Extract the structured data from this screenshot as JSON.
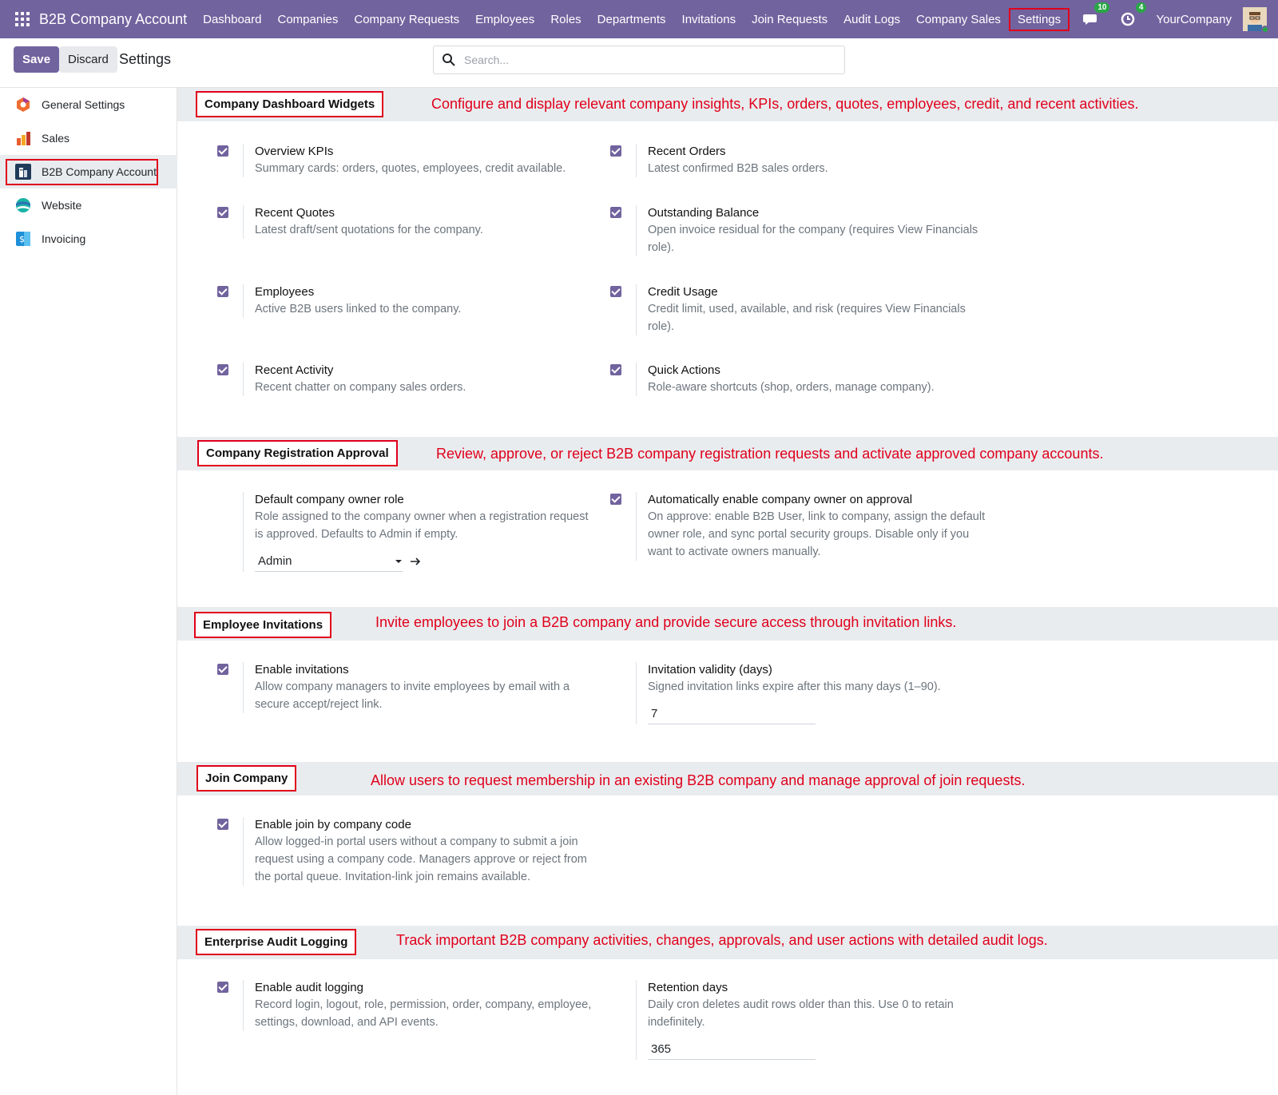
{
  "navbar": {
    "app_title": "B2B Company Account",
    "menu": [
      "Dashboard",
      "Companies",
      "Company Requests",
      "Employees",
      "Roles",
      "Departments",
      "Invitations",
      "Join Requests",
      "Audit Logs",
      "Company Sales",
      "Settings"
    ],
    "active_menu": "Settings",
    "messages_badge": "10",
    "activities_badge": "4",
    "company": "YourCompany"
  },
  "control_panel": {
    "save_label": "Save",
    "discard_label": "Discard",
    "title": "Settings",
    "search_placeholder": "Search..."
  },
  "sidebar": {
    "items": [
      {
        "label": "General Settings",
        "icon": "odoo-icon"
      },
      {
        "label": "Sales",
        "icon": "sales-icon"
      },
      {
        "label": "B2B Company Account",
        "icon": "b2b-company-icon",
        "active": true
      },
      {
        "label": "Website",
        "icon": "website-icon"
      },
      {
        "label": "Invoicing",
        "icon": "invoicing-icon"
      }
    ]
  },
  "sections": {
    "dashboard": {
      "title": "Company Dashboard Widgets",
      "description": "Configure and display relevant company insights, KPIs, orders, quotes, employees, credit, and recent activities.",
      "settings": [
        {
          "label": "Overview KPIs",
          "help": "Summary cards: orders, quotes, employees, credit available.",
          "checked": true
        },
        {
          "label": "Recent Orders",
          "help": "Latest confirmed B2B sales orders.",
          "checked": true
        },
        {
          "label": "Recent Quotes",
          "help": "Latest draft/sent quotations for the company.",
          "checked": true
        },
        {
          "label": "Outstanding Balance",
          "help": "Open invoice residual for the company (requires View Financials role).",
          "checked": true
        },
        {
          "label": "Employees",
          "help": "Active B2B users linked to the company.",
          "checked": true
        },
        {
          "label": "Credit Usage",
          "help": "Credit limit, used, available, and risk (requires View Financials role).",
          "checked": true
        },
        {
          "label": "Recent Activity",
          "help": "Recent chatter on company sales orders.",
          "checked": true
        },
        {
          "label": "Quick Actions",
          "help": "Role-aware shortcuts (shop, orders, manage company).",
          "checked": true
        }
      ]
    },
    "registration": {
      "title": "Company Registration Approval",
      "description": "Review, approve, or reject B2B company registration requests and activate approved company accounts.",
      "owner_role": {
        "label": "Default company owner role",
        "help": "Role assigned to the company owner when a registration request is approved. Defaults to Admin if empty.",
        "value": "Admin"
      },
      "auto_enable": {
        "label": "Automatically enable company owner on approval",
        "help": "On approve: enable B2B User, link to company, assign the default owner role, and sync portal security groups. Disable only if you want to activate owners manually.",
        "checked": true
      }
    },
    "invitations": {
      "title": "Employee Invitations",
      "description": "Invite employees to join a B2B company and provide secure access through invitation links.",
      "enable": {
        "label": "Enable invitations",
        "help": "Allow company managers to invite employees by email with a secure accept/reject link.",
        "checked": true
      },
      "validity": {
        "label": "Invitation validity (days)",
        "help": "Signed invitation links expire after this many days (1–90).",
        "value": "7"
      }
    },
    "join": {
      "title": "Join Company",
      "description": "Allow users to request membership in an existing B2B company and manage approval of join requests.",
      "enable": {
        "label": "Enable join by company code",
        "help": "Allow logged-in portal users without a company to submit a join request using a company code. Managers approve or reject from the portal queue. Invitation-link join remains available.",
        "checked": true
      }
    },
    "audit": {
      "title": "Enterprise Audit Logging",
      "description": "Track important B2B company activities, changes, approvals, and user actions with detailed audit logs.",
      "enable": {
        "label": "Enable audit logging",
        "help": "Record login, logout, role, permission, order, company, employee, settings, download, and API events.",
        "checked": true
      },
      "retention": {
        "label": "Retention days",
        "help": "Daily cron deletes audit rows older than this. Use 0 to retain indefinitely.",
        "value": "365"
      }
    }
  },
  "colors": {
    "primary": "#71639e",
    "annotation": "#e0001b",
    "badge": "#28a745"
  }
}
